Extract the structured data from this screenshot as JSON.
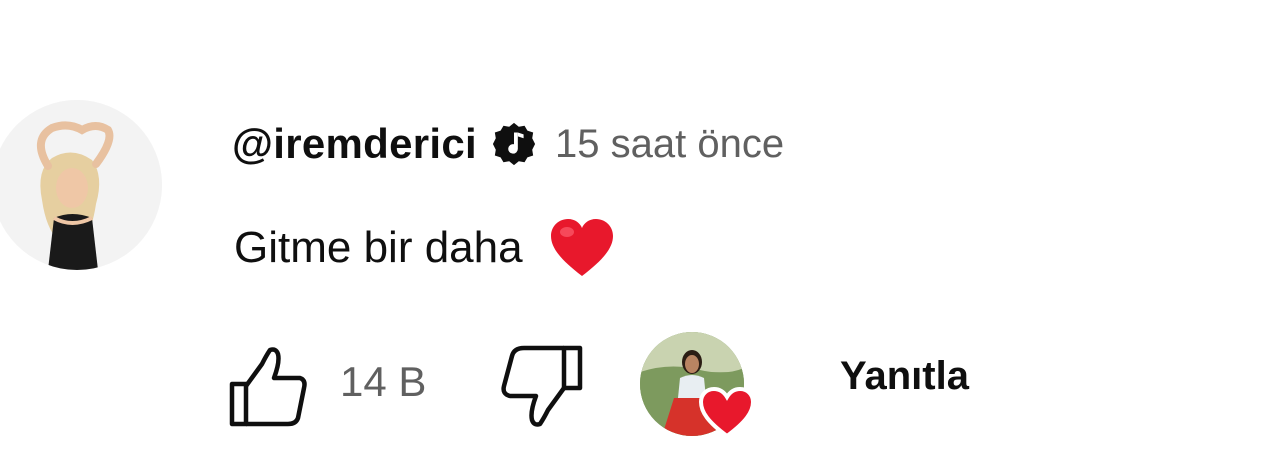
{
  "comment": {
    "author_handle": "@iremderici",
    "timestamp": "15 saat önce",
    "text": "Gitme bir daha",
    "emoji_icon": "red-heart-emoji",
    "verified_icon": "verified-music-badge-icon"
  },
  "actions": {
    "like_icon": "thumbs-up-icon",
    "like_count": "14 B",
    "dislike_icon": "thumbs-down-icon",
    "creator_heart_icon": "creator-heart-icon",
    "reply_label": "Yanıtla"
  },
  "colors": {
    "text_primary": "#0f0f0f",
    "text_secondary": "#606060",
    "heart_red": "#e8182c",
    "background": "#ffffff"
  }
}
